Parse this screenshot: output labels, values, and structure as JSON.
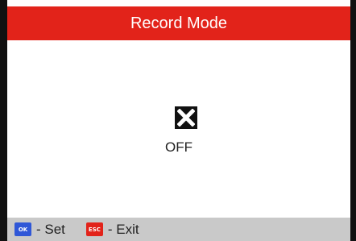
{
  "header": {
    "title": "Record Mode",
    "color": "#e2231a"
  },
  "status": {
    "icon": "x-icon",
    "label": "OFF"
  },
  "footer": {
    "ok_key": "OK",
    "set_label": "- Set",
    "esc_key": "ESC",
    "exit_label": "- Exit",
    "ok_color": "#2f57d7",
    "esc_color": "#e2231a"
  }
}
